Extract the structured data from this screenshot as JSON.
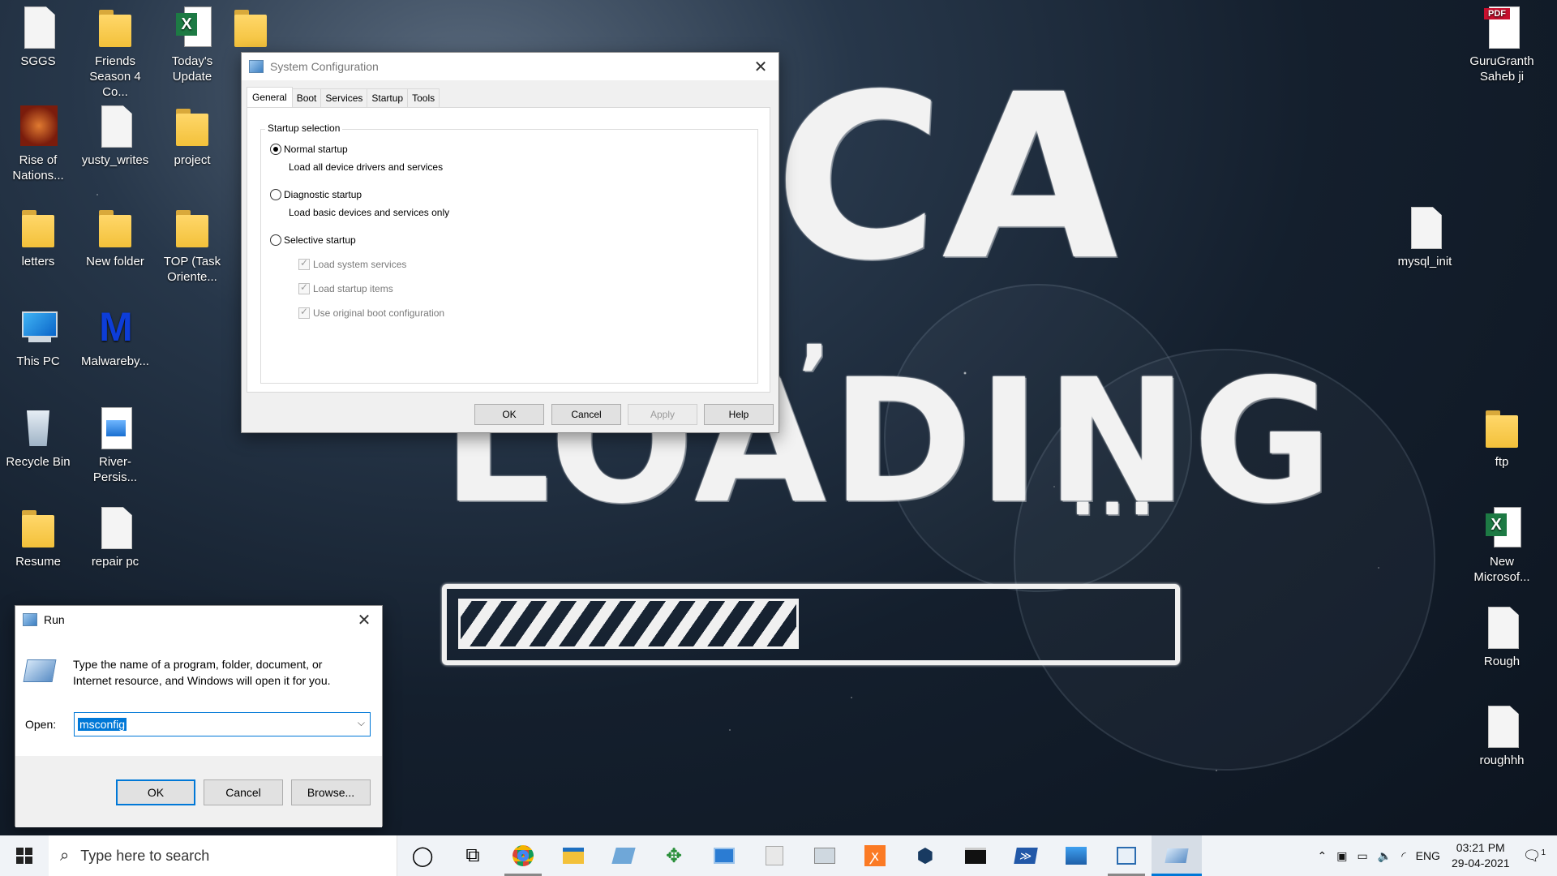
{
  "desktop": {
    "wallpaper_text": {
      "big": "CA",
      "load": "LOADING",
      "dots": "..."
    },
    "icons": [
      {
        "id": "sggs",
        "label": "SGGS",
        "icon": "file-icon"
      },
      {
        "id": "friends",
        "label": "Friends\nSeason 4 Co...",
        "icon": "folder-shortcut-icon"
      },
      {
        "id": "today",
        "label": "Today's\nUpdate",
        "icon": "excel-icon"
      },
      {
        "id": "rise",
        "label": "Rise of\nNations...",
        "icon": "game-icon"
      },
      {
        "id": "yusty",
        "label": "yusty_writes",
        "icon": "file-icon"
      },
      {
        "id": "project",
        "label": "project",
        "icon": "folder-icon"
      },
      {
        "id": "letters",
        "label": "letters",
        "icon": "folder-icon"
      },
      {
        "id": "newfolder",
        "label": "New folder",
        "icon": "folder-icon"
      },
      {
        "id": "top",
        "label": "TOP (Task\nOriente...",
        "icon": "folder-icon"
      },
      {
        "id": "thispc",
        "label": "This PC",
        "icon": "computer-icon"
      },
      {
        "id": "malware",
        "label": "Malwareby...",
        "icon": "malwarebytes-icon"
      },
      {
        "id": "recycle",
        "label": "Recycle Bin",
        "icon": "recycle-bin-icon"
      },
      {
        "id": "river",
        "label": "River-Persis...",
        "icon": "image-file-icon"
      },
      {
        "id": "resume",
        "label": "Resume",
        "icon": "folder-icon"
      },
      {
        "id": "repair",
        "label": "repair pc",
        "icon": "file-icon"
      },
      {
        "id": "guru",
        "label": "GuruGranth\nSaheb ji",
        "icon": "pdf-icon"
      },
      {
        "id": "mysql",
        "label": "mysql_init",
        "icon": "file-icon"
      },
      {
        "id": "ftp",
        "label": "ftp",
        "icon": "folder-icon"
      },
      {
        "id": "newms",
        "label": "New\nMicrosof...",
        "icon": "excel-icon"
      },
      {
        "id": "rough",
        "label": "Rough",
        "icon": "file-icon"
      },
      {
        "id": "roughhh",
        "label": "roughhh",
        "icon": "file-icon"
      }
    ]
  },
  "msconfig": {
    "title": "System Configuration",
    "tabs": [
      "General",
      "Boot",
      "Services",
      "Startup",
      "Tools"
    ],
    "group_title": "Startup selection",
    "options": [
      {
        "label": "Normal startup",
        "desc": "Load all device drivers and services",
        "selected": true
      },
      {
        "label": "Diagnostic startup",
        "desc": "Load basic devices and services only",
        "selected": false
      },
      {
        "label": "Selective startup",
        "desc": "",
        "selected": false
      }
    ],
    "checks": [
      "Load system services",
      "Load startup items",
      "Use original boot configuration"
    ],
    "buttons": {
      "ok": "OK",
      "cancel": "Cancel",
      "apply": "Apply",
      "help": "Help"
    }
  },
  "run": {
    "title": "Run",
    "description": "Type the name of a program, folder, document, or Internet resource, and Windows will open it for you.",
    "open_label": "Open:",
    "open_value": "msconfig",
    "buttons": {
      "ok": "OK",
      "cancel": "Cancel",
      "browse": "Browse..."
    }
  },
  "taskbar": {
    "search_placeholder": "Type here to search",
    "language": "ENG",
    "time": "03:21 PM",
    "date": "29-04-2021",
    "notification_count": "1",
    "apps": [
      "cortana-icon",
      "task-view-icon",
      "chrome-icon",
      "file-explorer-icon",
      "app-icon",
      "app-icon",
      "app-icon",
      "app-icon",
      "app-icon",
      "xampp-icon",
      "virtualbox-icon",
      "terminal-icon",
      "powershell-icon",
      "photos-icon",
      "msconfig-icon",
      "run-icon"
    ]
  }
}
